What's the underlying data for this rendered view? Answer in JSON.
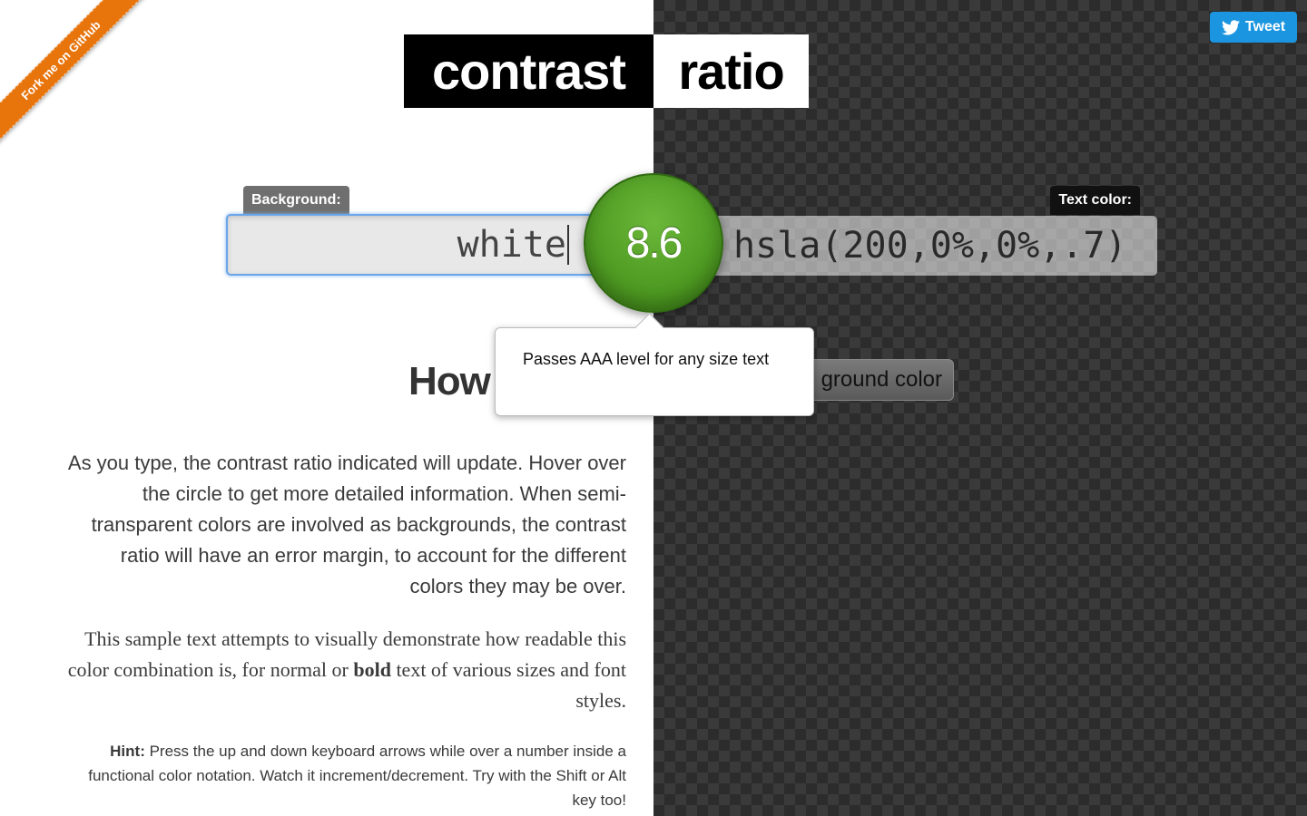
{
  "ribbon": {
    "label": "Fork me on GitHub"
  },
  "tweet": {
    "label": "Tweet"
  },
  "title": {
    "part1": "contrast",
    "part2": "ratio"
  },
  "background": {
    "label": "Background:",
    "value": "white"
  },
  "foreground": {
    "label": "Text color:",
    "value": "hsla(200,0%,0%,.7)"
  },
  "ratio": {
    "value": "8.6",
    "tooltip": "Passes AAA level for any size text"
  },
  "heading": {
    "visible_text": "How"
  },
  "swap_button": {
    "visible_text": "ground color"
  },
  "intro": "As you type, the contrast ratio indicated will update. Hover over the circle to get more detailed information. When semi-transparent colors are involved as backgrounds, the contrast ratio will have an error margin, to account for the different colors they may be over.",
  "sample": {
    "before": "This sample text attempts to visually demonstrate how readable this color combination is, for normal or ",
    "bold": "bold",
    "after": " text of various sizes and font styles."
  },
  "hint": {
    "label": "Hint:",
    "text": " Press the up and down keyboard arrows while over a number inside a functional color notation. Watch it increment/decrement. Try with the Shift or Alt key too!"
  },
  "colors": {
    "accent_green": "#4e9a22",
    "tweet_blue": "#1b95e0",
    "ribbon_orange": "#e8740c",
    "focus_blue": "#6aa6ea"
  }
}
